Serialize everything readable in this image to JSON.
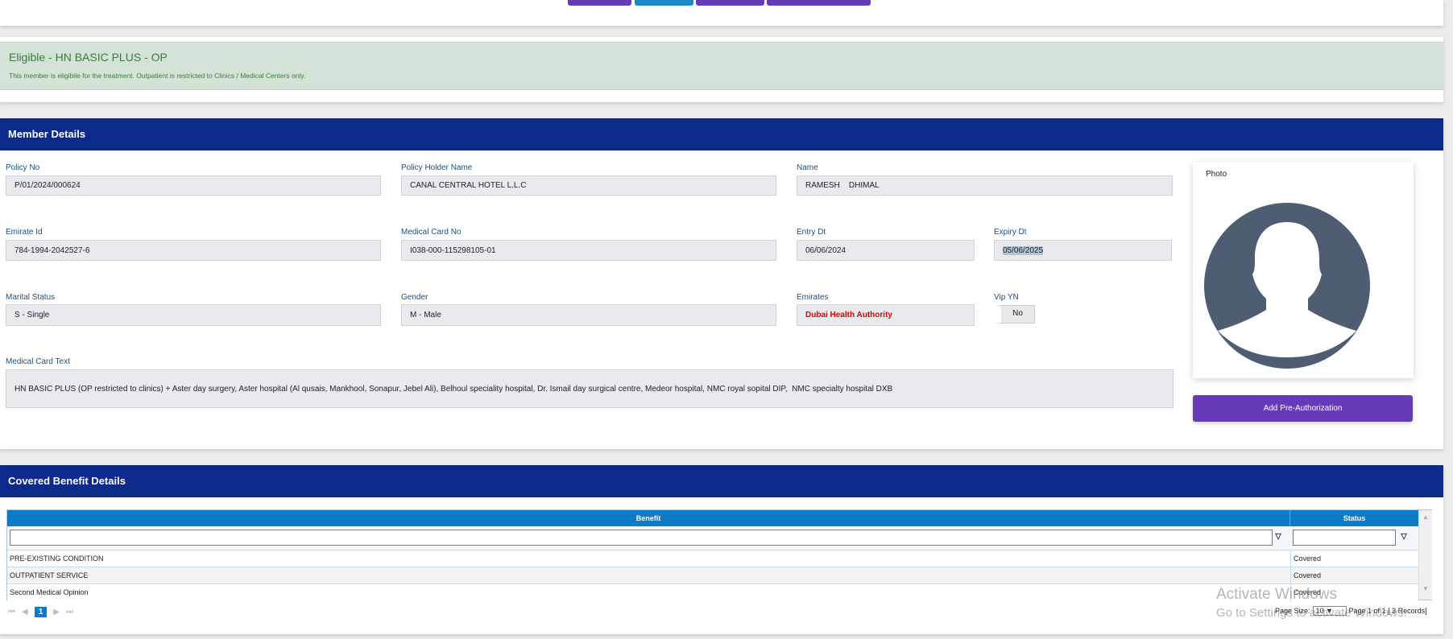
{
  "top_buttons": [
    {
      "color": "#673ab7"
    },
    {
      "color": "#1e88c8"
    },
    {
      "color": "#673ab7"
    },
    {
      "color": "#673ab7"
    }
  ],
  "eligibility": {
    "title": "Eligible - HN BASIC PLUS - OP",
    "message": "This member is eligibile for the treatment. Outpatient is restricted to Clinics / Medical Centers only."
  },
  "member": {
    "header": "Member Details",
    "policy_no": {
      "label": "Policy No",
      "value": "P/01/2024/000624"
    },
    "policy_holder": {
      "label": "Policy Holder Name",
      "value": "CANAL CENTRAL HOTEL L.L.C"
    },
    "name": {
      "label": "Name",
      "value": "RAMESH    DHIMAL"
    },
    "emirate_id": {
      "label": "Emirate Id",
      "value": "784-1994-2042527-6"
    },
    "medical_card_no": {
      "label": "Medical Card No",
      "value": "I038-000-115298105-01"
    },
    "entry_dt": {
      "label": "Entry Dt",
      "value": "06/06/2024"
    },
    "expiry_dt": {
      "label": "Expiry Dt",
      "value": "05/06/2025"
    },
    "marital_status": {
      "label": "Marital Status",
      "value": "S - Single"
    },
    "gender": {
      "label": "Gender",
      "value": "M - Male"
    },
    "emirates": {
      "label": "Emirates",
      "value": "Dubai Health Authority"
    },
    "vip": {
      "label": "Vip YN",
      "value": "No"
    },
    "card_text": {
      "label": "Medical Card Text",
      "value": "HN BASIC PLUS (OP restricted to clinics) + Aster day surgery, Aster hospital (Al qusais, Mankhool, Sonapur, Jebel Ali), Belhoul speciality hospital, Dr. Ismail day surgical centre, Medeor hospital, NMC royal sopital DIP,  NMC specialty hospital DXB"
    },
    "photo_label": "Photo",
    "add_preauth": "Add Pre-Authorization"
  },
  "benefits": {
    "header": "Covered Benefit Details",
    "columns": [
      "Benefit",
      "Status"
    ],
    "rows": [
      {
        "benefit": "PRE-EXISTING CONDITION",
        "status": "Covered"
      },
      {
        "benefit": "OUTPATIENT SERVICE",
        "status": "Covered"
      },
      {
        "benefit": "Second Medical Opinion",
        "status": "Covered"
      }
    ],
    "pager": {
      "current_page": "1",
      "page_size_label": "Page Size:",
      "page_size": "10",
      "page_info": "Page 1 of 1 [ 3 Records]"
    }
  },
  "watermark": {
    "line1": "Activate Windows",
    "line2": "Go to Settings to activate Windows."
  }
}
